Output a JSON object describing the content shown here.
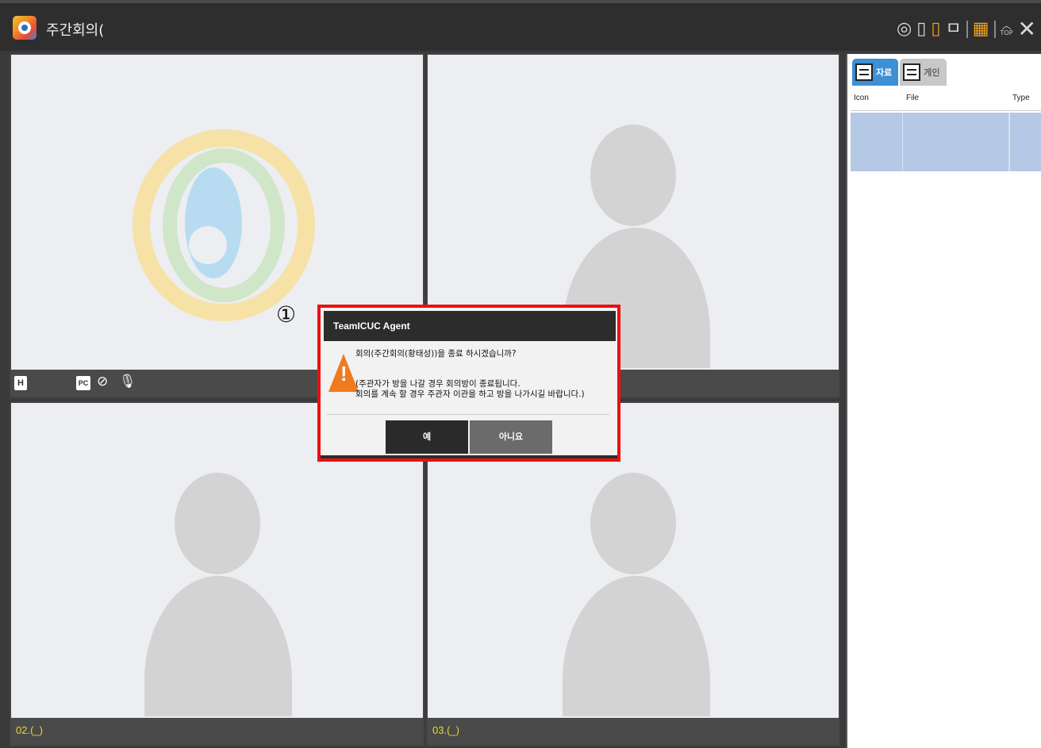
{
  "window": {
    "title": "주간회의(",
    "toolbar": {
      "icons": [
        "refresh-icon",
        "layout-single-icon",
        "layout-split-icon",
        "layout-list-icon",
        "grid-icon",
        "top-icon",
        "close-icon"
      ],
      "top_label": "TOP",
      "close_glyph": "✕"
    }
  },
  "video_tiles": [
    {
      "id": "tile-1",
      "label": "",
      "bar_badges": {
        "h": "H",
        "pc": "PC"
      },
      "placeholder": "app-logo"
    },
    {
      "id": "tile-2",
      "label": "",
      "placeholder": "person"
    },
    {
      "id": "tile-3",
      "label": "02.(_)",
      "placeholder": "person"
    },
    {
      "id": "tile-4",
      "label": "03.(_)",
      "placeholder": "person"
    }
  ],
  "side_panel": {
    "tabs": [
      {
        "label": "자료",
        "active": true
      },
      {
        "label": "게인",
        "active": false
      }
    ],
    "columns": [
      "Icon",
      "File",
      "Type"
    ]
  },
  "annotation_marker": "①",
  "dialog": {
    "title": "TeamICUC Agent",
    "message_line1": "회의(주간회의(황태성))을 종료 하시겠습니까?",
    "message_line2": "(주관자가 방을 나갈 경우 회의방이 종료됩니다.",
    "message_line3": "회의를 계속 할 경우 주관자 이관을 하고 방을 나가시길 바랍니다.)",
    "yes_label": "예",
    "no_label": "아니요",
    "highlight_color": "#ee0f0f",
    "warning_color": "#f07a1e"
  }
}
